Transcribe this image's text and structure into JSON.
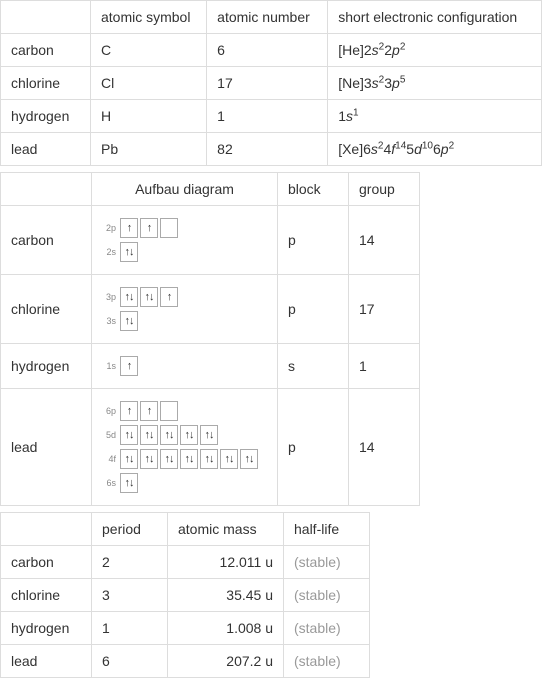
{
  "table1": {
    "headers": [
      "",
      "atomic symbol",
      "atomic number",
      "short electronic configuration"
    ],
    "rows": [
      {
        "name": "carbon",
        "symbol": "C",
        "number": "6",
        "config": {
          "prefix": "[He]",
          "parts": [
            [
              "2",
              "s",
              "2"
            ],
            [
              "2",
              "p",
              "2"
            ]
          ]
        }
      },
      {
        "name": "chlorine",
        "symbol": "Cl",
        "number": "17",
        "config": {
          "prefix": "[Ne]",
          "parts": [
            [
              "3",
              "s",
              "2"
            ],
            [
              "3",
              "p",
              "5"
            ]
          ]
        }
      },
      {
        "name": "hydrogen",
        "symbol": "H",
        "number": "1",
        "config": {
          "prefix": "",
          "parts": [
            [
              "1",
              "s",
              "1"
            ]
          ]
        }
      },
      {
        "name": "lead",
        "symbol": "Pb",
        "number": "82",
        "config": {
          "prefix": "[Xe]",
          "parts": [
            [
              "6",
              "s",
              "2"
            ],
            [
              "4",
              "f",
              "14"
            ],
            [
              "5",
              "d",
              "10"
            ],
            [
              "6",
              "p",
              "2"
            ]
          ]
        }
      }
    ]
  },
  "table2": {
    "headers": [
      "",
      "Aufbau diagram",
      "block",
      "group"
    ],
    "rows": [
      {
        "name": "carbon",
        "block": "p",
        "group": "14",
        "aufbau": [
          {
            "label": "2p",
            "orbitals": [
              "↑",
              "↑",
              ""
            ]
          },
          {
            "label": "2s",
            "orbitals": [
              "↑↓"
            ]
          }
        ]
      },
      {
        "name": "chlorine",
        "block": "p",
        "group": "17",
        "aufbau": [
          {
            "label": "3p",
            "orbitals": [
              "↑↓",
              "↑↓",
              "↑"
            ]
          },
          {
            "label": "3s",
            "orbitals": [
              "↑↓"
            ]
          }
        ]
      },
      {
        "name": "hydrogen",
        "block": "s",
        "group": "1",
        "aufbau": [
          {
            "label": "1s",
            "orbitals": [
              "↑"
            ]
          }
        ]
      },
      {
        "name": "lead",
        "block": "p",
        "group": "14",
        "aufbau": [
          {
            "label": "6p",
            "orbitals": [
              "↑",
              "↑",
              ""
            ]
          },
          {
            "label": "5d",
            "orbitals": [
              "↑↓",
              "↑↓",
              "↑↓",
              "↑↓",
              "↑↓"
            ]
          },
          {
            "label": "4f",
            "orbitals": [
              "↑↓",
              "↑↓",
              "↑↓",
              "↑↓",
              "↑↓",
              "↑↓",
              "↑↓"
            ]
          },
          {
            "label": "6s",
            "orbitals": [
              "↑↓"
            ]
          }
        ]
      }
    ]
  },
  "table3": {
    "headers": [
      "",
      "period",
      "atomic mass",
      "half-life"
    ],
    "rows": [
      {
        "name": "carbon",
        "period": "2",
        "mass": "12.011 u",
        "halflife": "(stable)"
      },
      {
        "name": "chlorine",
        "period": "3",
        "mass": "35.45 u",
        "halflife": "(stable)"
      },
      {
        "name": "hydrogen",
        "period": "1",
        "mass": "1.008 u",
        "halflife": "(stable)"
      },
      {
        "name": "lead",
        "period": "6",
        "mass": "207.2 u",
        "halflife": "(stable)"
      }
    ]
  },
  "chart_data": {
    "type": "table",
    "elements": [
      {
        "name": "carbon",
        "symbol": "C",
        "atomic_number": 6,
        "config": "[He]2s2 2p2",
        "block": "p",
        "group": 14,
        "period": 2,
        "atomic_mass_u": 12.011,
        "half_life": "(stable)"
      },
      {
        "name": "chlorine",
        "symbol": "Cl",
        "atomic_number": 17,
        "config": "[Ne]3s2 3p5",
        "block": "p",
        "group": 17,
        "period": 3,
        "atomic_mass_u": 35.45,
        "half_life": "(stable)"
      },
      {
        "name": "hydrogen",
        "symbol": "H",
        "atomic_number": 1,
        "config": "1s1",
        "block": "s",
        "group": 1,
        "period": 1,
        "atomic_mass_u": 1.008,
        "half_life": "(stable)"
      },
      {
        "name": "lead",
        "symbol": "Pb",
        "atomic_number": 82,
        "config": "[Xe]6s2 4f14 5d10 6p2",
        "block": "p",
        "group": 14,
        "period": 6,
        "atomic_mass_u": 207.2,
        "half_life": "(stable)"
      }
    ]
  }
}
